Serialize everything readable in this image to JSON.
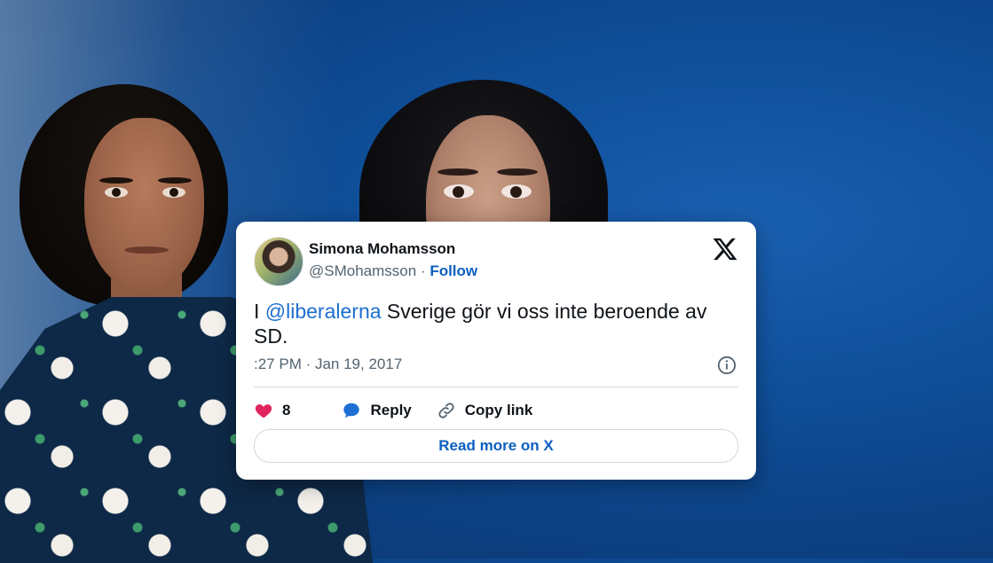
{
  "tweet": {
    "author_name": "Simona Mohamsson",
    "handle": "@SMohamsson",
    "separator": " · ",
    "follow_label": "Follow",
    "text_prefix": "I ",
    "mention": "@liberalerna",
    "text_suffix": " Sverige gör vi oss inte beroende av SD.",
    "timestamp": ":27 PM · Jan 19, 2017",
    "like_count": "8",
    "reply_label": "Reply",
    "copy_link_label": "Copy link",
    "read_more_label": "Read more on X"
  },
  "colors": {
    "background_blue": "#0f4f9a",
    "link_blue": "#1d6fd1",
    "button_text_blue": "#0b5fc0"
  },
  "icons": [
    "x-logo-icon",
    "info-icon",
    "heart-icon",
    "reply-bubble-icon",
    "link-icon"
  ]
}
